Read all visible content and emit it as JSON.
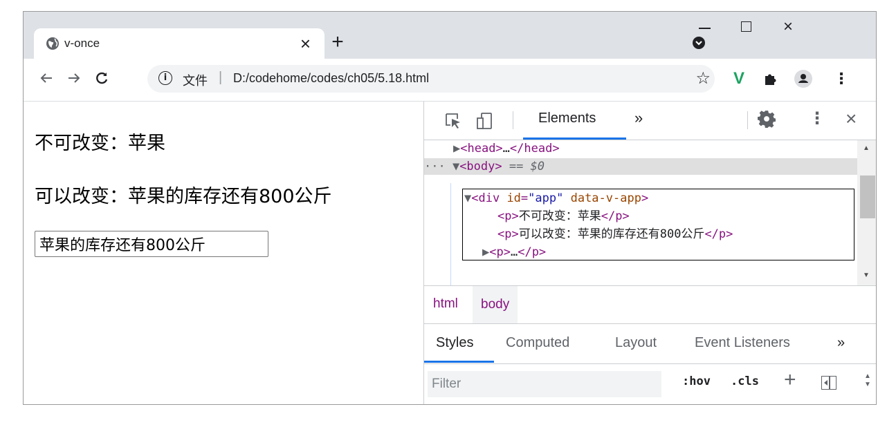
{
  "browser": {
    "tab": {
      "title": "v-once",
      "close": "×"
    },
    "new_tab": "+",
    "window_controls": {
      "close": "×"
    },
    "omnibox": {
      "scheme_label": "文件",
      "separator": "|",
      "url": "D:/codehome/codes/ch05/5.18.html",
      "info": "i",
      "star": "☆"
    },
    "extensions": {
      "vue": "V",
      "menu": "⋮"
    }
  },
  "page": {
    "line1": "不可改变：苹果",
    "line2": "可以改变：苹果的库存还有800公斤",
    "input_value": "苹果的库存还有800公斤"
  },
  "devtools": {
    "tabs": {
      "elements": "Elements",
      "more": "»"
    },
    "kebab": "⋮",
    "close": "×",
    "dom": {
      "head": {
        "open": "<head>",
        "ellipsis": "…",
        "close": "</head>"
      },
      "body": {
        "prefix": "··· ▼",
        "tag": "<body>",
        "eq": " == $0"
      },
      "div": {
        "tag_open": "<div",
        "attr1_name": " id",
        "attr1_eq": "=",
        "attr1_val": "\"app\"",
        "attr2": " data-v-app",
        "tag_end": ">"
      },
      "p1": {
        "open": "<p>",
        "text": "不可改变：苹果",
        "close": "</p>"
      },
      "p2": {
        "open": "<p>",
        "text": "可以改变：苹果的库存还有800公斤",
        "close": "</p>"
      },
      "p_collapsed": {
        "open": "<p>",
        "ellipsis": "…",
        "close": "</p>"
      }
    },
    "breadcrumbs": [
      "html",
      "body"
    ],
    "subtabs": [
      "Styles",
      "Computed",
      "Layout",
      "Event Listeners",
      "»"
    ],
    "filter": {
      "placeholder": "Filter",
      "hov": ":hov",
      "cls": ".cls",
      "plus": "+"
    }
  }
}
